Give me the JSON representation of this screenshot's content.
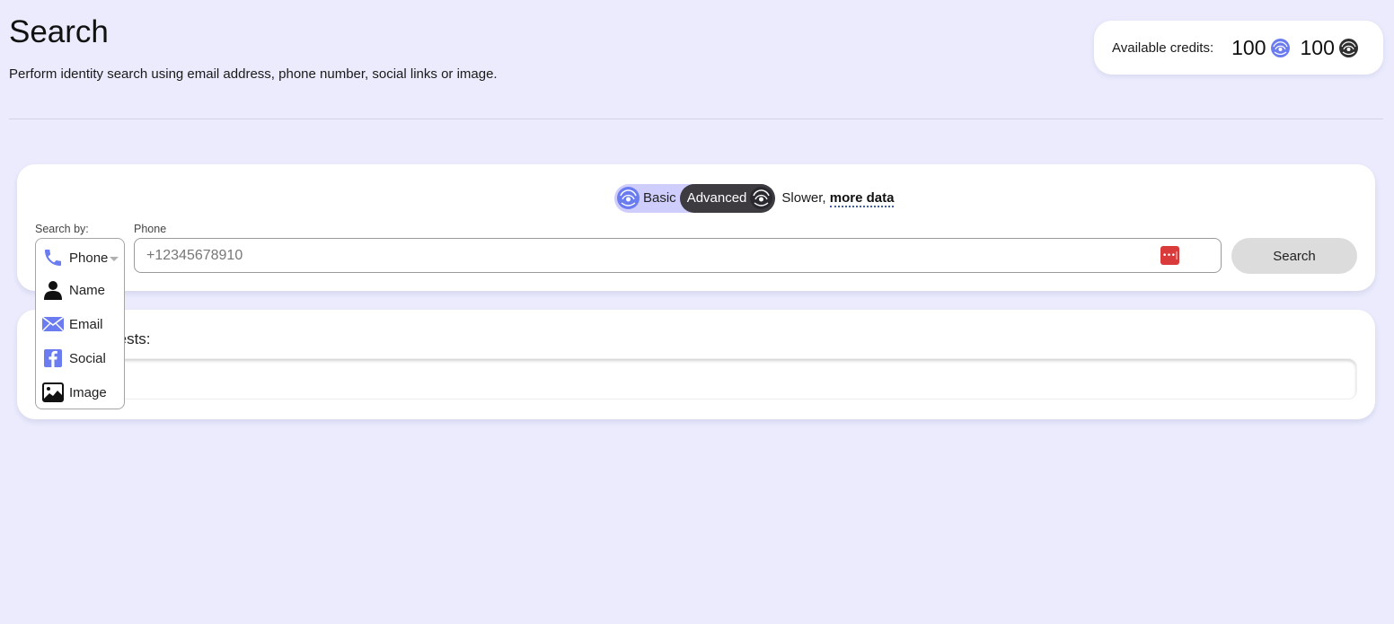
{
  "header": {
    "title": "Search",
    "subtitle": "Perform identity search using email address, phone number, social links or image."
  },
  "credits": {
    "label": "Available credits:",
    "basic_value": "100",
    "advanced_value": "100",
    "basic_icon": "basic-credit-coin-icon",
    "advanced_icon": "advanced-credit-coin-icon"
  },
  "mode": {
    "options": [
      {
        "label": "Basic",
        "icon": "basic-mode-icon",
        "selected": false
      },
      {
        "label": "Advanced",
        "icon": "advanced-mode-icon",
        "selected": true
      }
    ],
    "description_prefix": "Slower, ",
    "description_link": "more data"
  },
  "search_form": {
    "search_by_label": "Search by:",
    "selected_type": "Phone",
    "field_label": "Phone",
    "input_value": "",
    "input_placeholder": "+12345678910",
    "search_button": "Search"
  },
  "search_types": [
    {
      "label": "Phone",
      "icon": "phone-icon",
      "color": "#6a7cf0"
    },
    {
      "label": "Name",
      "icon": "person-icon",
      "color": "#111111"
    },
    {
      "label": "Email",
      "icon": "envelope-icon",
      "color": "#6a7cf0"
    },
    {
      "label": "Social",
      "icon": "facebook-icon",
      "color": "#6a7cf0"
    },
    {
      "label": "Image",
      "icon": "image-icon",
      "color": "#111111"
    }
  ],
  "recent": {
    "title_visible": "equests:",
    "title_full": "Recent requests:"
  },
  "colors": {
    "background": "#ebebfd",
    "accent_blue": "#6a7cf0",
    "toggle_bg": "#cfcdfc",
    "toggle_active": "#3d3a40",
    "password_manager_red": "#d93a3a",
    "button_grey": "#dcdcdc"
  }
}
